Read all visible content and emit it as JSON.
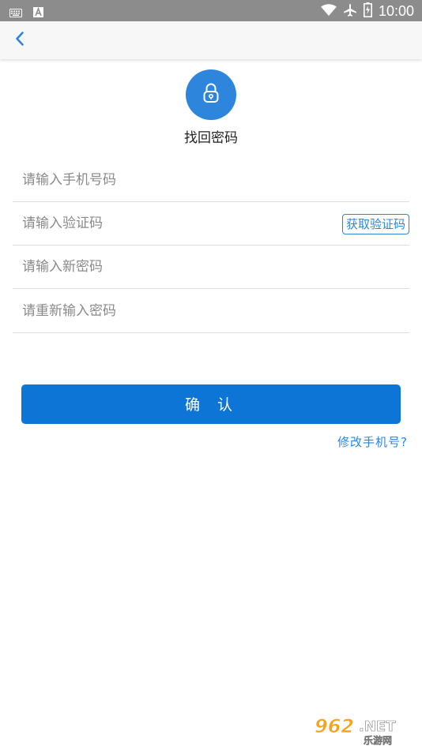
{
  "status_bar": {
    "time": "10:00",
    "icons": [
      "keyboard-icon",
      "font-a-icon",
      "wifi-icon",
      "airplane-icon",
      "battery-icon"
    ]
  },
  "toolbar": {
    "back_icon": "chevron-left-icon"
  },
  "header": {
    "icon": "lock-icon",
    "title": "找回密码"
  },
  "form": {
    "phone_placeholder": "请输入手机号码",
    "code_placeholder": "请输入验证码",
    "get_code_label": "获取验证码",
    "new_password_placeholder": "请输入新密码",
    "confirm_password_placeholder": "请重新输入密码"
  },
  "actions": {
    "confirm_label": "确认",
    "change_phone_label": "修改手机号?"
  },
  "watermark": {
    "brand": "962.NET",
    "sub": "乐游网"
  },
  "colors": {
    "accent": "#2d86dc",
    "button": "#0d75d6",
    "status_bar": "#8c8c8c"
  }
}
